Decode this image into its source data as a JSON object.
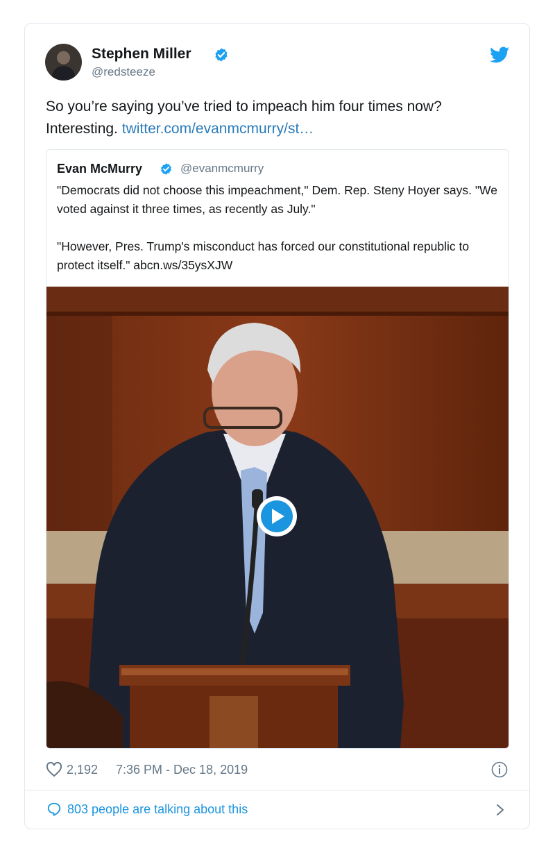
{
  "tweet": {
    "author_name": "Stephen Miller",
    "author_handle": "@redsteeze",
    "text_prefix": "So you’re saying you’ve tried to impeach him four times now? Interesting. ",
    "link": "twitter.com/evanmcmurry/st…",
    "likes": "2,192",
    "timestamp": "7:36 PM - Dec 18, 2019",
    "talking": "803 people are talking about this"
  },
  "quoted": {
    "author_name": "Evan McMurry",
    "author_handle": "@evanmcmurry",
    "paragraph1": "\"Democrats did not choose this impeachment,\" Dem. Rep. Steny Hoyer says. \"We voted against it three times, as recently as July.\"",
    "paragraph2": "\"However, Pres. Trump's misconduct has forced our constitutional republic to protect itself.\" abcn.ws/35ysXJW"
  },
  "icons": {
    "verified": "verified-badge-icon",
    "bird": "twitter-bird-icon",
    "play": "play-icon",
    "heart": "heart-icon",
    "info": "info-icon",
    "bubble": "comment-bubble-icon",
    "chevron": "chevron-right-icon"
  },
  "colors": {
    "accent": "#1da1f2",
    "link": "#2b7bb9",
    "muted": "#657786",
    "border": "#e1e8ed"
  }
}
